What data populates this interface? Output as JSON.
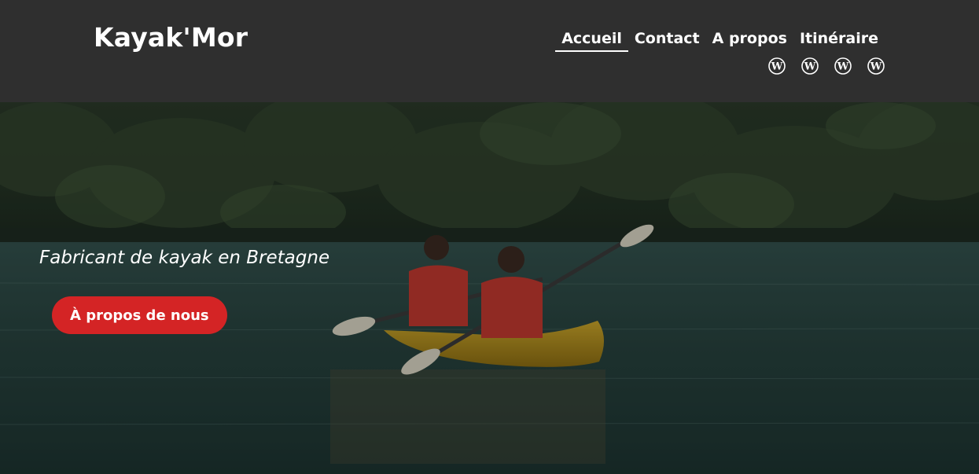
{
  "header": {
    "brand": "Kayak'Mor",
    "nav": [
      {
        "label": "Accueil",
        "active": true
      },
      {
        "label": "Contact"
      },
      {
        "label": "A propos"
      },
      {
        "label": "Itinéraire"
      }
    ],
    "social_icons": [
      "wordpress-icon",
      "wordpress-icon",
      "wordpress-icon",
      "wordpress-icon"
    ]
  },
  "hero": {
    "tagline": "Fabricant de kayak en Bretagne",
    "cta_label": "À propos de nous",
    "image": "two people paddling a yellow tandem kayak on a green river with a forest background"
  },
  "colors": {
    "header_bg": "#2f2f2f",
    "cta_bg": "#d42425",
    "text": "#ffffff"
  }
}
